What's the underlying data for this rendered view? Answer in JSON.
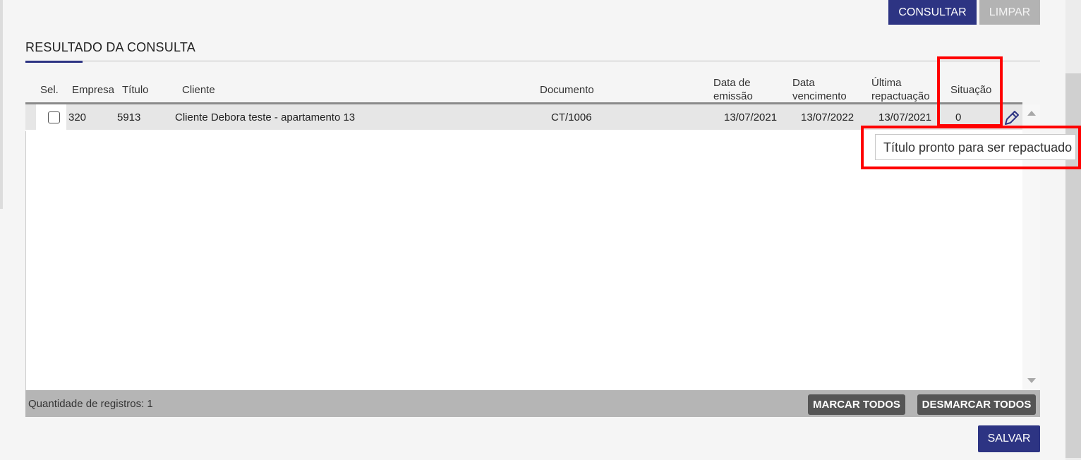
{
  "toolbar": {
    "consultar_label": "CONSULTAR",
    "limpar_label": "LIMPAR"
  },
  "section": {
    "title": "RESULTADO DA CONSULTA"
  },
  "table": {
    "headers": {
      "sel": "Sel.",
      "empresa": "Empresa",
      "titulo": "Título",
      "cliente": "Cliente",
      "documento": "Documento",
      "data_emissao_1": "Data de",
      "data_emissao_2": "emissão",
      "data_venc_1": "Data",
      "data_venc_2": "vencimento",
      "ultima_rep_1": "Última",
      "ultima_rep_2": "repactuação",
      "situacao": "Situação"
    },
    "rows": [
      {
        "empresa": "320",
        "titulo": "5913",
        "cliente": "Cliente Debora teste - apartamento 13",
        "documento": "CT/1006",
        "data_emissao": "13/07/2021",
        "data_vencimento": "13/07/2022",
        "ultima_repactuacao": "13/07/2021",
        "situacao": "0",
        "selected": false,
        "edit_icon": "pencil-icon"
      }
    ]
  },
  "tooltip": {
    "text": "Título pronto para ser repactuado"
  },
  "footer": {
    "count_text": "Quantidade de registros: 1",
    "marcar_label": "MARCAR TODOS",
    "desmarcar_label": "DESMARCAR TODOS"
  },
  "actions": {
    "salvar_label": "SALVAR"
  },
  "colors": {
    "primary": "#2d3483",
    "highlight": "#ff0000"
  }
}
